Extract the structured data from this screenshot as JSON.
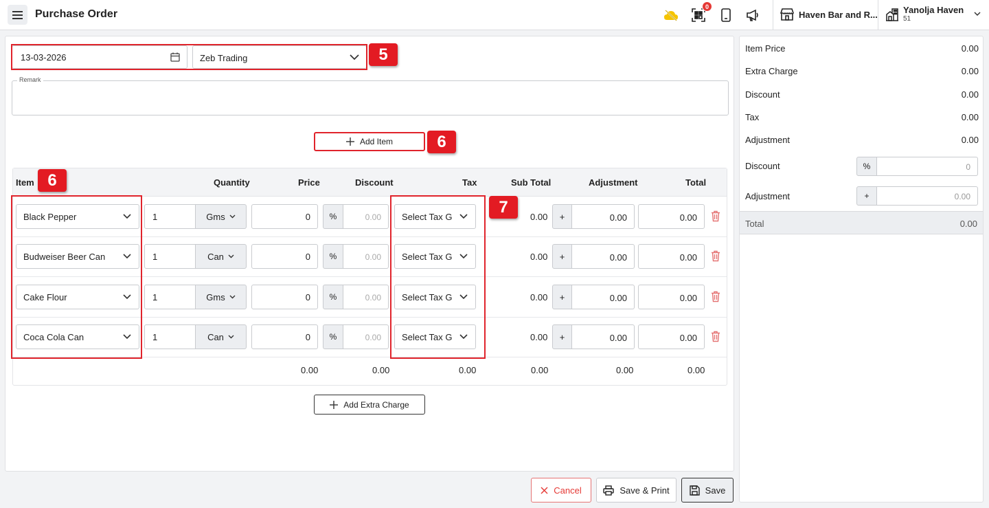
{
  "header": {
    "title": "Purchase Order",
    "notification_count": "0",
    "store_name": "Haven Bar and R...",
    "user_name": "Yanolja Haven",
    "user_id": "51"
  },
  "form": {
    "date": "13-03-2026",
    "vendor": "Zeb Trading",
    "remark_label": "Remark",
    "remark_value": "",
    "add_item_label": "Add Item",
    "add_extra_charge_label": "Add Extra Charge"
  },
  "annotations": {
    "badge_5": "5",
    "badge_6a": "6",
    "badge_6b": "6",
    "badge_7": "7"
  },
  "table": {
    "headers": {
      "item": "Item",
      "quantity": "Quantity",
      "price": "Price",
      "discount": "Discount",
      "tax": "Tax",
      "sub_total": "Sub Total",
      "adjustment": "Adjustment",
      "total": "Total"
    },
    "rows": [
      {
        "item": "Black Pepper",
        "qty": "1",
        "unit": "Gms",
        "price": "0",
        "disc_type": "%",
        "disc": "0.00",
        "tax": "Select Tax G",
        "sub_total": "0.00",
        "adj_type": "+",
        "adj": "0.00",
        "total": "0.00"
      },
      {
        "item": "Budweiser Beer Can",
        "qty": "1",
        "unit": "Can",
        "price": "0",
        "disc_type": "%",
        "disc": "0.00",
        "tax": "Select Tax G",
        "sub_total": "0.00",
        "adj_type": "+",
        "adj": "0.00",
        "total": "0.00"
      },
      {
        "item": "Cake Flour",
        "qty": "1",
        "unit": "Gms",
        "price": "0",
        "disc_type": "%",
        "disc": "0.00",
        "tax": "Select Tax G",
        "sub_total": "0.00",
        "adj_type": "+",
        "adj": "0.00",
        "total": "0.00"
      },
      {
        "item": "Coca Cola Can",
        "qty": "1",
        "unit": "Can",
        "price": "0",
        "disc_type": "%",
        "disc": "0.00",
        "tax": "Select Tax G",
        "sub_total": "0.00",
        "adj_type": "+",
        "adj": "0.00",
        "total": "0.00"
      }
    ],
    "footer": {
      "price": "0.00",
      "discount": "0.00",
      "tax": "0.00",
      "sub_total": "0.00",
      "adjustment": "0.00",
      "total": "0.00"
    }
  },
  "actions": {
    "cancel": "Cancel",
    "save_print": "Save & Print",
    "save": "Save"
  },
  "summary": {
    "item_price_label": "Item Price",
    "item_price": "0.00",
    "extra_charge_label": "Extra Charge",
    "extra_charge": "0.00",
    "discount_label": "Discount",
    "discount": "0.00",
    "tax_label": "Tax",
    "tax": "0.00",
    "adjustment_label": "Adjustment",
    "adjustment": "0.00",
    "discount_input_label": "Discount",
    "discount_type": "%",
    "discount_input": "0",
    "adjustment_input_label": "Adjustment",
    "adjustment_type": "+",
    "adjustment_input": "0.00",
    "total_label": "Total",
    "total": "0.00"
  },
  "colors": {
    "annotation_red": "#e31b23",
    "cancel_red": "#e53935",
    "trash_red": "#e57373",
    "accent_yellow": "#f5c400"
  }
}
